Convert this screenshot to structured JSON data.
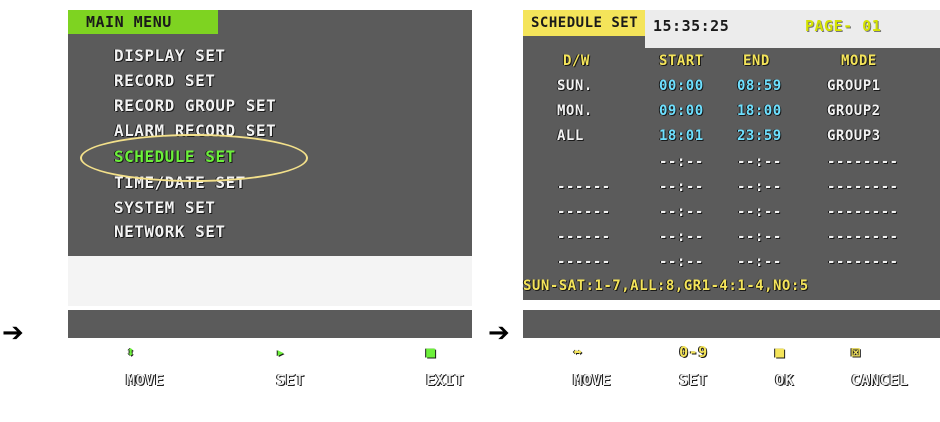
{
  "arrows": [
    "➔",
    "➔"
  ],
  "main_menu": {
    "title": "MAIN MENU",
    "items": [
      "DISPLAY SET",
      "RECORD SET",
      "RECORD GROUP SET",
      "ALARM RECORD SET",
      "SCHEDULE SET",
      "TIME/DATE SET",
      "SYSTEM SET",
      "NETWORK SET"
    ],
    "selected": "SCHEDULE SET",
    "footer": [
      {
        "icon": "⬍",
        "label": "MOVE"
      },
      {
        "icon": "▸",
        "label": "SET"
      },
      {
        "icon": "■",
        "label": "EXIT"
      }
    ]
  },
  "schedule": {
    "title": "SCHEDULE SET",
    "clock": "15:35:25",
    "page": "PAGE- 01",
    "headers": [
      "D/W",
      "START",
      "END",
      "MODE"
    ],
    "rows": [
      [
        "SUN.",
        "00:00",
        "08:59",
        "GROUP1"
      ],
      [
        "MON.",
        "09:00",
        "18:00",
        "GROUP2"
      ],
      [
        "ALL",
        "18:01",
        "23:59",
        "GROUP3"
      ],
      [
        "",
        "--:--",
        "--:--",
        "--------"
      ],
      [
        "------",
        "--:--",
        "--:--",
        "--------"
      ],
      [
        "------",
        "--:--",
        "--:--",
        "--------"
      ],
      [
        "------",
        "--:--",
        "--:--",
        "--------"
      ],
      [
        "------",
        "--:--",
        "--:--",
        "--------"
      ]
    ],
    "legend": "SUN-SAT:1-7,ALL:8,GR1-4:1-4,NO:5",
    "footer": [
      {
        "icon": "⬌",
        "label": "MOVE"
      },
      {
        "icon": "0-9",
        "label": "SET"
      },
      {
        "icon": "■",
        "label": "OK"
      },
      {
        "icon": "⊠",
        "label": "CANCEL"
      }
    ]
  },
  "colors": {
    "panel": "#5b5b5b",
    "menu_title_bg": "#7ed321",
    "schedule_title_bg": "#f4e45a",
    "selected_text": "#6cf03a",
    "highlight_ring": "#f3e08a"
  }
}
